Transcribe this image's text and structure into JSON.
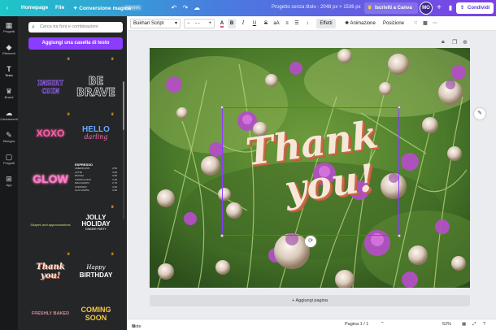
{
  "topbar": {
    "home": "Homepage",
    "file": "File",
    "magic": "Conversione magica",
    "new_badge": "NOVITÀ",
    "doc_title": "Progetto senza titolo - 2048 px × 1536 px",
    "pro": "Iscriviti a Canva Pro",
    "avatar": "MO",
    "plus": "+",
    "share": "Condividi"
  },
  "rail": [
    {
      "label": "Progetti",
      "icon": "▦"
    },
    {
      "label": "Elementi",
      "icon": "◆"
    },
    {
      "label": "Testo",
      "icon": "T"
    },
    {
      "label": "Brand",
      "icon": "♛"
    },
    {
      "label": "Caricamenti",
      "icon": "☁"
    },
    {
      "label": "Disegno",
      "icon": "✎"
    },
    {
      "label": "Progetti",
      "icon": "▢"
    },
    {
      "label": "App",
      "icon": "⊞"
    }
  ],
  "panel": {
    "search_placeholder": "Cerca tra font e combinazioni",
    "add_text": "Aggiungi una casella di testo",
    "tiles": {
      "insert_coin_1": "INSERT",
      "insert_coin_2": "COIN",
      "be_brave_1": "BE",
      "be_brave_2": "BRAVE",
      "xoxo": "XOXO",
      "hello_1": "HELLO",
      "hello_2": "darling",
      "glow": "GLOW",
      "menu_title": "ESPRESSO",
      "menu_rows": [
        "AMERICANO",
        "LATTE",
        "MOCHA",
        "CAPPUCCINO",
        "MACCHIATO",
        "CORTADO",
        "FLAT WHITE"
      ],
      "menu_prices": [
        "2.50",
        "3.00",
        "3.50",
        "3.25",
        "2.75",
        "3.00",
        "3.50"
      ],
      "shapes": "Shapes and approximations",
      "jolly_1": "JOLLY",
      "jolly_2": "HOLIDAY",
      "jolly_3": "DINNER PARTY",
      "thank_1": "Thank",
      "thank_2": "you!",
      "bday_1": "Happy",
      "bday_2": "BIRTHDAY",
      "fresh": "FRESHLY BAKED",
      "coming_1": "COMING",
      "coming_2": "SOON"
    }
  },
  "toolbar": {
    "font": "Bukhari Script",
    "size": "- -",
    "effects": "Effetti",
    "animation": "Animazione",
    "position": "Posizione"
  },
  "canvas": {
    "line1": "Thank",
    "line2": "you!",
    "add_page": "+ Aggiungi pagina"
  },
  "bottombar": {
    "notes": "Note",
    "page": "Pagina 1 / 1",
    "zoom": "52%"
  }
}
